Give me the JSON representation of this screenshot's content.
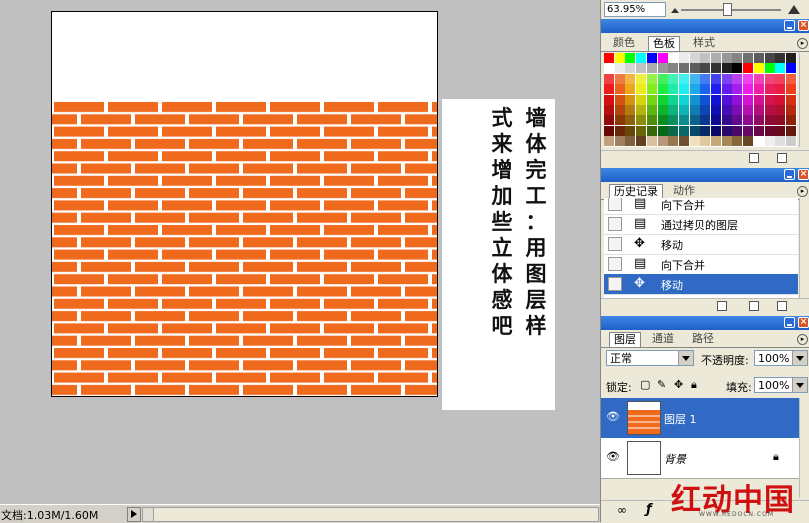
{
  "navigator": {
    "zoom": "63.95%"
  },
  "swatches_panel": {
    "tabs": [
      "颜色",
      "色板",
      "样式"
    ],
    "active_tab": "色板"
  },
  "history_panel": {
    "tabs": [
      "历史记录",
      "动作"
    ],
    "active_tab": "历史记录",
    "items": [
      {
        "label": "向下合并",
        "icon": "document-icon",
        "selected": false
      },
      {
        "label": "通过拷贝的图层",
        "icon": "document-icon",
        "selected": false
      },
      {
        "label": "移动",
        "icon": "move-tool-icon",
        "selected": false
      },
      {
        "label": "向下合并",
        "icon": "document-icon",
        "selected": false
      },
      {
        "label": "移动",
        "icon": "move-tool-icon",
        "selected": true
      }
    ]
  },
  "layers_panel": {
    "tabs": [
      "图层",
      "通道",
      "路径"
    ],
    "active_tab": "图层",
    "blend_mode": "正常",
    "opacity_label": "不透明度:",
    "opacity": "100%",
    "lock_label": "锁定:",
    "fill_label": "填充:",
    "fill": "100%",
    "layers": [
      {
        "name": "图层 1",
        "selected": true
      },
      {
        "name": "背景",
        "selected": false,
        "locked": true
      }
    ]
  },
  "canvas_note": {
    "columns": [
      "墙体完工：用图层样",
      "式来增加些立体感吧"
    ]
  },
  "status": {
    "doc_info": "文档:1.03M/1.60M"
  },
  "watermark": {
    "text": "红动中国",
    "subtext": "WWW.REDOCN.COM"
  },
  "colors": {
    "brick": "#f06a1e",
    "mortar": "#ffffff",
    "title_bar": "#2a6ad8",
    "selection": "#316ac5"
  }
}
